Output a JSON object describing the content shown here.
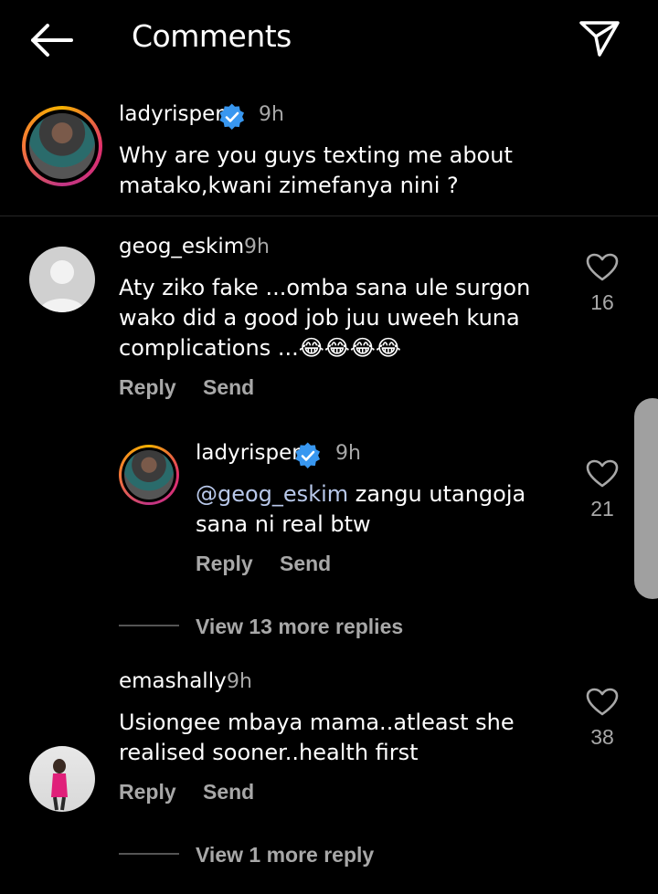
{
  "header": {
    "title": "Comments",
    "back_icon": "arrow-left-icon",
    "send_icon": "paper-plane-icon"
  },
  "caption": {
    "username": "ladyrisper",
    "verified": true,
    "time": "9h",
    "text_line1": "Why are you guys texting me about",
    "text_line2": "matako,kwani zimefanya nini ?"
  },
  "comments": [
    {
      "username": "geog_eskim",
      "time": "9h",
      "line1": "Aty ziko fake ...omba sana ule surgon",
      "line2": "wako did a good job juu uweeh kuna",
      "line3": "complications ...😂😂😂😂",
      "likes": "16",
      "reply_label": "Reply",
      "send_label": "Send",
      "reply": {
        "username": "ladyrisper",
        "verified": true,
        "time": "9h",
        "mention": "@geog_eskim",
        "line1_rest": " zangu utangoja",
        "line2": "sana ni real btw",
        "likes": "21",
        "reply_label": "Reply",
        "send_label": "Send"
      },
      "view_more": "View 13 more replies"
    },
    {
      "username": "emashally",
      "time": "9h",
      "line1": "Usiongee mbaya mama..atleast she",
      "line2": "realised  sooner..health first",
      "likes": "38",
      "reply_label": "Reply",
      "send_label": "Send",
      "view_more": "View 1 more reply"
    }
  ],
  "colors": {
    "background": "#000000",
    "secondary_text": "#a8a8a8",
    "verified_blue": "#3897f0",
    "mention": "#b8c8ea"
  }
}
